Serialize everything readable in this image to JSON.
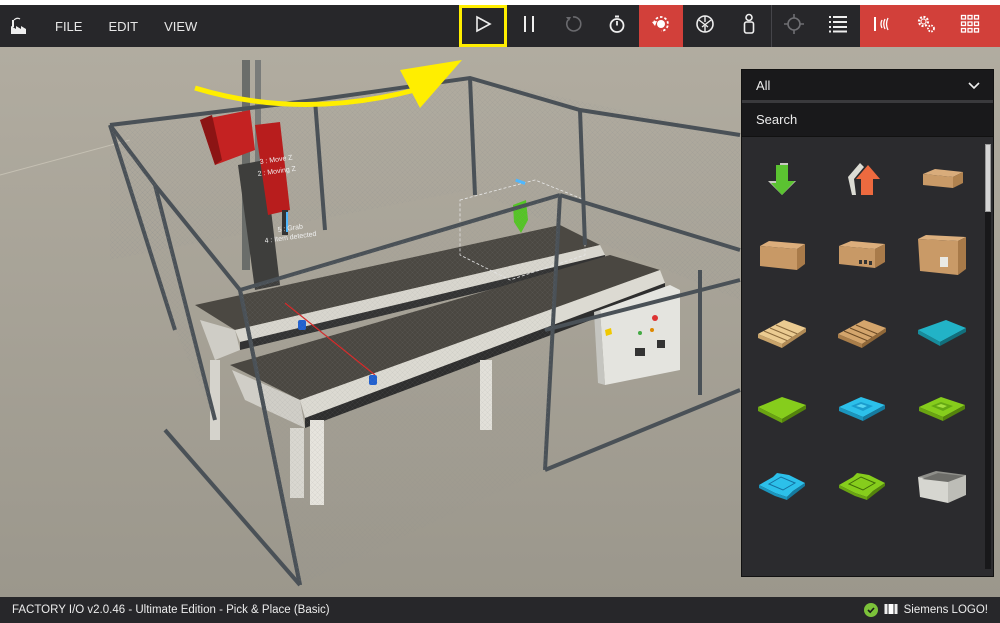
{
  "app": {
    "title": "FACTORY I/O v2.0.46 - Ultimate Edition - Pick & Place (Basic)"
  },
  "menu": {
    "items": [
      {
        "label": "FILE"
      },
      {
        "label": "EDIT"
      },
      {
        "label": "VIEW"
      }
    ]
  },
  "toolbar": {
    "buttons": [
      {
        "name": "play-button",
        "icon": "play-icon",
        "highlighted": true
      },
      {
        "name": "pause-button",
        "icon": "pause-icon"
      },
      {
        "name": "reset-button",
        "icon": "reset-icon",
        "disabled": true
      },
      {
        "name": "timer-button",
        "icon": "stopwatch-icon"
      },
      {
        "name": "orbit-camera-button",
        "icon": "orbit-camera-icon",
        "active": true
      },
      {
        "name": "fly-camera-button",
        "icon": "aperture-icon"
      },
      {
        "name": "first-person-button",
        "icon": "person-icon"
      },
      {
        "name": "pick-button",
        "icon": "crosshair-icon"
      },
      {
        "name": "scene-list-button",
        "icon": "list-icon"
      },
      {
        "name": "sensors-button",
        "icon": "sensor-signal-icon",
        "active": true
      },
      {
        "name": "drivers-button",
        "icon": "gears-icon",
        "active": true
      },
      {
        "name": "palette-button",
        "icon": "grid-icon",
        "active": true
      }
    ],
    "accent_color": "#d2403a",
    "highlight_color": "#ffee00"
  },
  "scene": {
    "labels": {
      "move_z": "3 : Move Z",
      "moving_z": "2 : Moving Z",
      "grab": "5 : Grab",
      "item_detected": "4 : Item detected"
    },
    "annotation": "yellow-arrow-pointing-to-play"
  },
  "palette": {
    "filter_selected": "All",
    "search_placeholder": "Search",
    "scroll_fraction": 0.16,
    "items": [
      {
        "name": "emitter",
        "icon": "emitter-green-arrow-icon"
      },
      {
        "name": "remover",
        "icon": "remover-orange-arrow-icon"
      },
      {
        "name": "small-box",
        "icon": "small-box-icon"
      },
      {
        "name": "medium-box",
        "icon": "medium-box-icon"
      },
      {
        "name": "medium-box-2",
        "icon": "medium-box-labeled-icon"
      },
      {
        "name": "large-box",
        "icon": "large-box-icon"
      },
      {
        "name": "pallet-light",
        "icon": "pallet-light-icon"
      },
      {
        "name": "pallet-dark",
        "icon": "pallet-dark-icon"
      },
      {
        "name": "blue-raw-material",
        "icon": "teal-plate-icon"
      },
      {
        "name": "green-raw-material",
        "icon": "green-plate-icon"
      },
      {
        "name": "blue-product-base",
        "icon": "blue-base-icon"
      },
      {
        "name": "green-product-base",
        "icon": "green-base-icon"
      },
      {
        "name": "blue-product-lid",
        "icon": "blue-lid-icon"
      },
      {
        "name": "green-product-lid",
        "icon": "green-lid-icon"
      },
      {
        "name": "stackable-box",
        "icon": "gray-crate-icon"
      }
    ]
  },
  "status": {
    "driver": "Siemens LOGO!",
    "connection_ok": true,
    "ok_color": "#7cc23a"
  }
}
